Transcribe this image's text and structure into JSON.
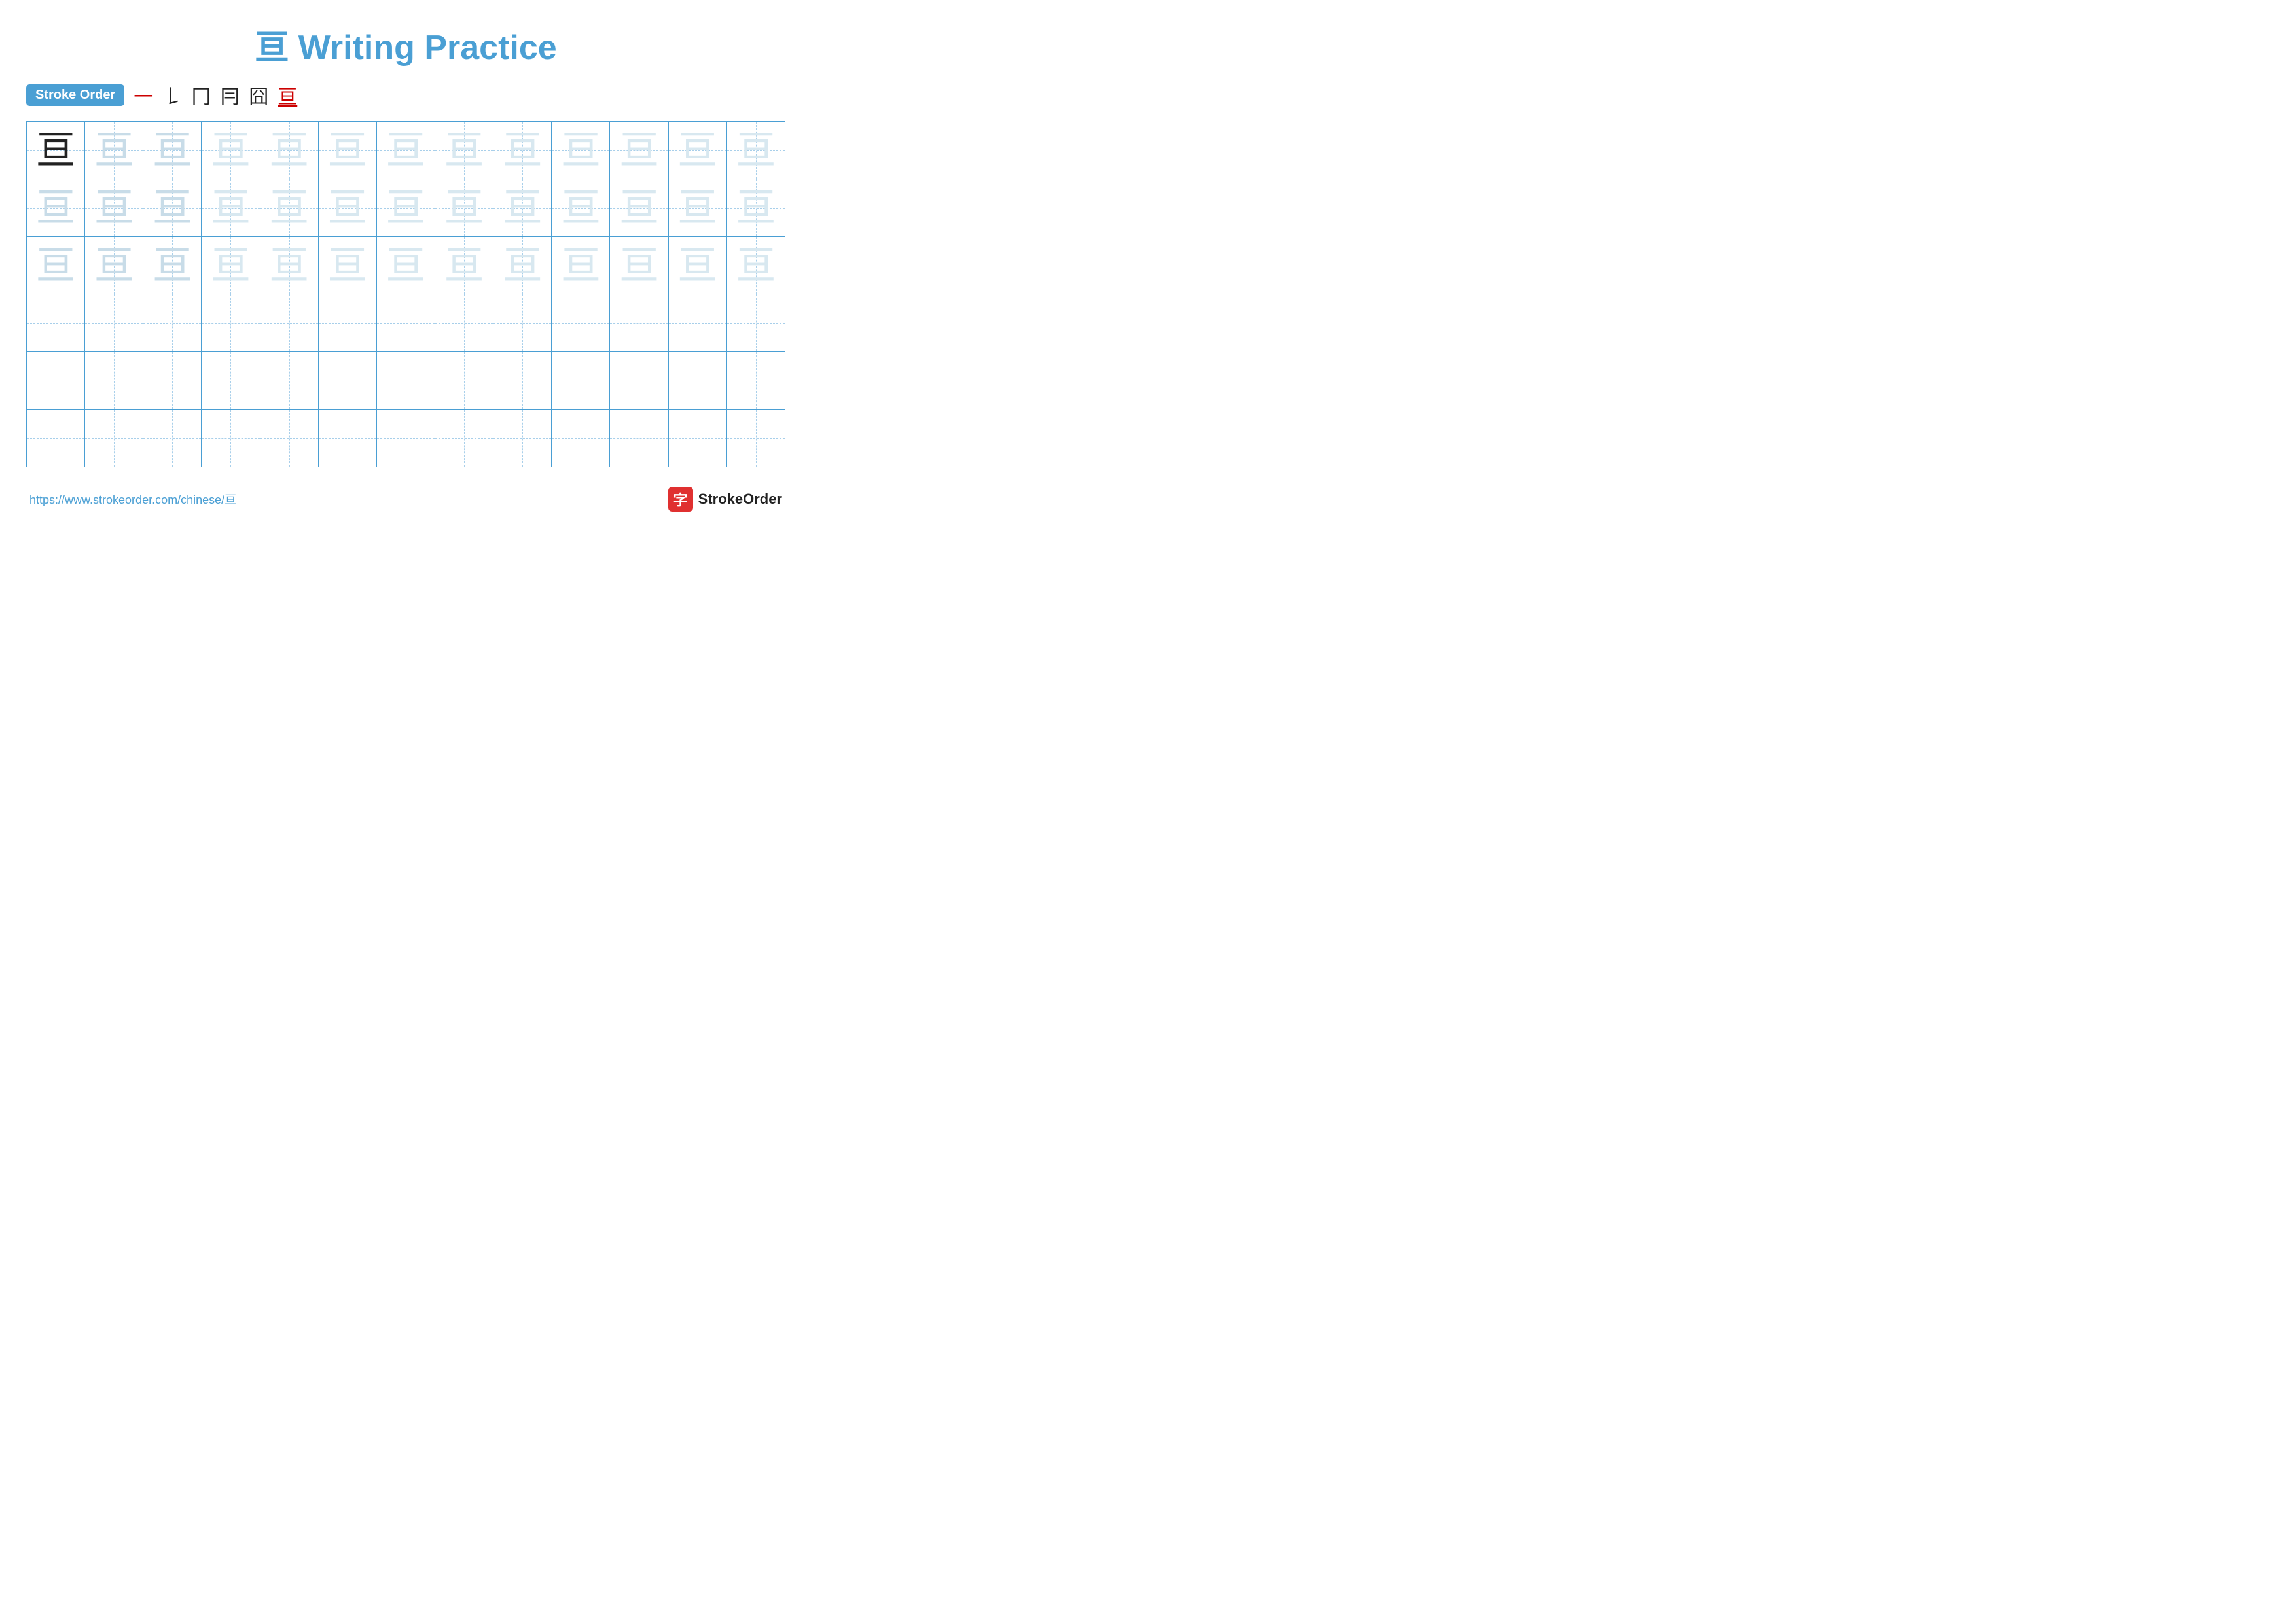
{
  "page": {
    "title": "亘 Writing Practice",
    "char": "亘",
    "stroke_order_label": "Stroke Order",
    "stroke_sequence": [
      "一",
      "𠄌",
      "冂",
      "冃",
      "囧",
      "亘"
    ],
    "last_stroke_underlined": true,
    "footer_url": "https://www.strokeorder.com/chinese/亘",
    "footer_brand": "StrokeOrder",
    "footer_icon": "字",
    "grid": {
      "rows": 6,
      "cols": 13,
      "filled_rows": 3
    }
  }
}
